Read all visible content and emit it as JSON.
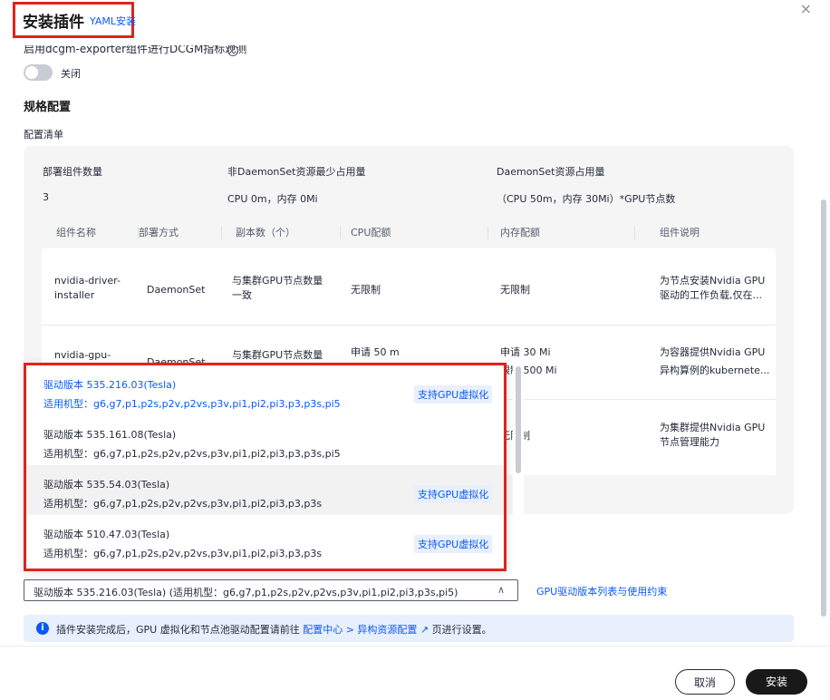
{
  "header": {
    "title": "安装插件",
    "yaml_link": "YAML安装",
    "close": "×"
  },
  "dcgm": {
    "label_cut": "启用dcgm-exporter组件进行DCGM指标观测",
    "help": "?",
    "toggle_label": "关闭",
    "toggle_on": false
  },
  "spec": {
    "heading": "规格配置",
    "list_heading": "配置清单"
  },
  "summary": {
    "labels": [
      "部署组件数量",
      "非DaemonSet资源最少占用量",
      "DaemonSet资源占用量"
    ],
    "values": [
      "3",
      "CPU 0m，内存 0Mi",
      "（CPU 50m，内存 30Mi）*GPU节点数"
    ]
  },
  "table": {
    "headers": [
      "组件名称",
      "部署方式",
      "副本数（个）",
      "CPU配额",
      "内存配额",
      "组件说明"
    ],
    "rows": [
      {
        "name": [
          "nvidia-driver-",
          "installer"
        ],
        "mode": "DaemonSet",
        "replicas": [
          "与集群GPU节点数量",
          "一致"
        ],
        "cpu": "无限制",
        "mem": "无限制",
        "desc": [
          "为节点安装Nvidia GPU",
          "驱动的工作负载,仅在..."
        ]
      },
      {
        "name": [
          "nvidia-gpu-"
        ],
        "mode": "DaemonSet",
        "replicas": [
          "与集群GPU节点数量"
        ],
        "cpu": "申请  50  m",
        "mem": [
          "申请  30  Mi",
          "限制  500  Mi"
        ],
        "desc": [
          "为容器提供Nvidia GPU",
          "异构算例的kubernete..."
        ]
      },
      {
        "mem": "无限制",
        "desc": [
          "为集群提供Nvidia GPU",
          "节点管理能力"
        ]
      }
    ]
  },
  "dropdown": {
    "options": [
      {
        "line1": "驱动版本 535.216.03(Tesla)",
        "line2": "适用机型：g6,g7,p1,p2s,p2v,p2vs,p3v,pi1,pi2,pi3,p3,p3s,pi5",
        "tag": "支持GPU虚拟化",
        "selected": true
      },
      {
        "line1": "驱动版本 535.161.08(Tesla)",
        "line2": "适用机型：g6,g7,p1,p2s,p2v,p2vs,p3v,pi1,pi2,pi3,p3,p3s,pi5",
        "tag": "",
        "selected": false
      },
      {
        "line1": "驱动版本 535.54.03(Tesla)",
        "line2": "适用机型：g6,g7,p1,p2s,p2v,p2vs,p3v,pi1,pi2,pi3,p3,p3s",
        "tag": "支持GPU虚拟化",
        "selected": false
      },
      {
        "line1": "驱动版本 510.47.03(Tesla)",
        "line2": "适用机型：g6,g7,p1,p2s,p2v,p2vs,p3v,pi1,pi2,pi3,p3,p3s",
        "tag": "支持GPU虚拟化",
        "selected": false
      }
    ]
  },
  "select": {
    "value": "驱动版本 535.216.03(Tesla) (适用机型：g6,g7,p1,p2s,p2v,p2vs,p3v,pi1,pi2,pi3,p3s,pi5)",
    "chevron": "∧"
  },
  "gpu_link": "GPU驱动版本列表与使用约束",
  "info": {
    "icon": "i",
    "text_before": "插件安装完成后，GPU 虚拟化和节点池驱动配置请前往 ",
    "link": "配置中心 > 异构资源配置",
    "ext": "↗",
    "text_after": " 页进行设置。"
  },
  "footer": {
    "cancel": "取消",
    "install": "安装"
  },
  "colors": {
    "accent": "#0a59f7",
    "highlight": "#e2231a",
    "primary_button": "#191919"
  }
}
